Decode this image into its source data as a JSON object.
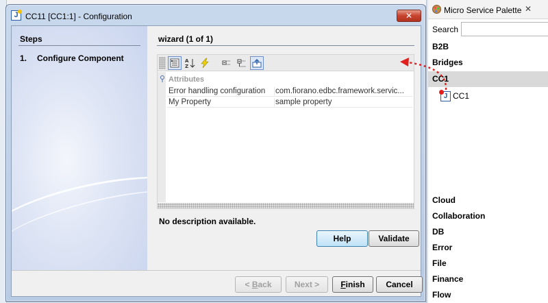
{
  "dialog": {
    "title": "CC11 [CC1:1] - Configuration",
    "close_glyph": "✕",
    "steps_title": "Steps",
    "steps": [
      {
        "number": "1.",
        "label": "Configure Component"
      }
    ],
    "wizard_title": "wizard (1 of 1)",
    "category": "Attributes",
    "properties": [
      {
        "name": "Error handling configuration",
        "value": "com.fiorano.edbc.framework.servic..."
      },
      {
        "name": "My Property",
        "value": "sample property"
      }
    ],
    "description": "No description available.",
    "buttons": {
      "help": "Help",
      "validate": "Validate",
      "back_mnemonic": "B",
      "back_rest": "ack",
      "back_prefix": "< ",
      "next": "Next >",
      "finish_mnemonic": "F",
      "finish_rest": "inish",
      "cancel": "Cancel"
    }
  },
  "palette": {
    "title": "Micro Service Palette",
    "close_glyph": "✕",
    "search_label": "Search",
    "search_value": "",
    "categories_top": [
      "B2B",
      "Bridges",
      "CC1"
    ],
    "selected_category": "CC1",
    "component": "CC1",
    "categories_bottom": [
      "Cloud",
      "Collaboration",
      "DB",
      "Error",
      "File",
      "Finance",
      "Flow"
    ]
  },
  "colors": {
    "annotation_arrow": "#e0201e",
    "selected_category_bg": "#d9d9d9"
  }
}
